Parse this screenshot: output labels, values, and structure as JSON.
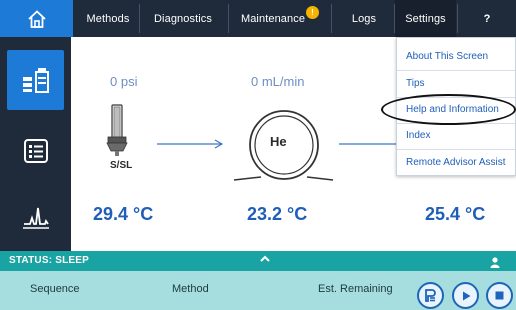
{
  "nav": {
    "items": [
      "Methods",
      "Diagnostics",
      "Maintenance",
      "Logs",
      "Settings",
      "?"
    ],
    "maintenance_badge": "!"
  },
  "rail": {
    "items": [
      "instrument-icon",
      "list-icon",
      "chromatogram-icon"
    ],
    "active_index": 0
  },
  "flow": {
    "inlet_pressure": "0 psi",
    "inlet_label": "S/SL",
    "inlet_temp": "29.4 °C",
    "column_flow": "0 mL/min",
    "column_gas": "He",
    "oven_temp": "23.2 °C",
    "detector_temp": "25.4 °C"
  },
  "settings_menu": {
    "items": [
      "About This Screen",
      "Tips",
      "Help and Information",
      "Index",
      "Remote Advisor Assist"
    ],
    "highlighted": "Help and Information"
  },
  "status": {
    "label": "STATUS: SLEEP"
  },
  "bottom": {
    "sequence_label": "Sequence",
    "method_label": "Method",
    "remaining_label": "Est. Remaining",
    "buttons": [
      "prep-run-icon",
      "play-icon",
      "stop-icon"
    ]
  },
  "colors": {
    "nav_bg": "#1f2b3a",
    "accent_blue": "#1d7ad6",
    "status_teal": "#1aa3a3",
    "bottom_bg": "#a6dedf",
    "value_blue": "#1f5fb8",
    "badge_amber": "#f4b400"
  }
}
